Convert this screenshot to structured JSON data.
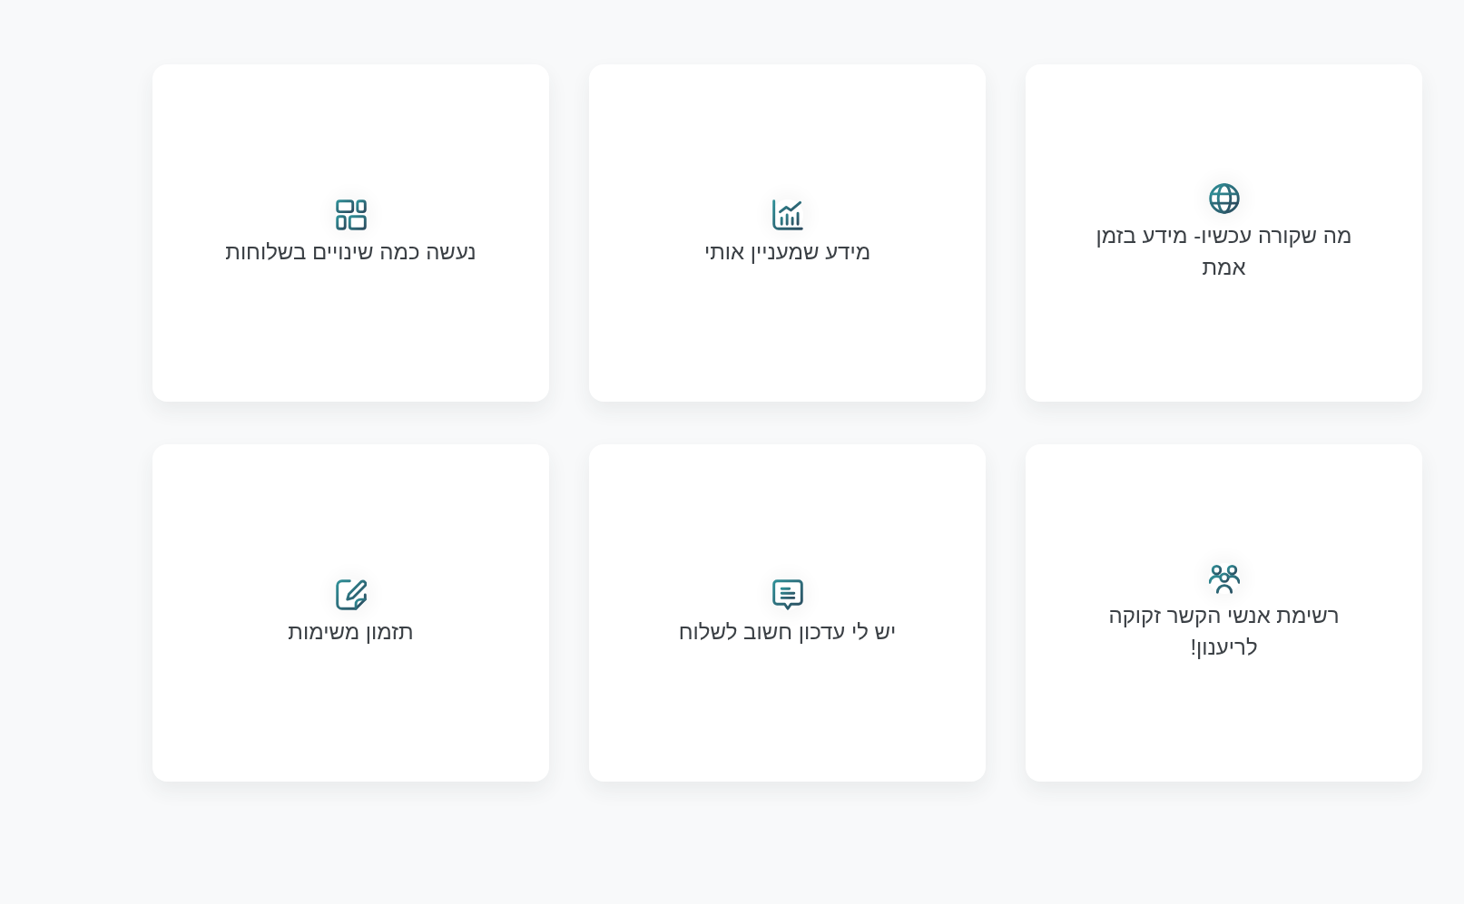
{
  "cards": [
    {
      "title": "מה שקורה עכשיו- מידע בזמן אמת"
    },
    {
      "title": "מידע שמעניין אותי"
    },
    {
      "title": "נעשה כמה שינויים בשלוחות"
    },
    {
      "title": "רשימת אנשי הקשר זקוקה לריענון!"
    },
    {
      "title": "יש לי עדכון חשוב לשלוח"
    },
    {
      "title": "תזמון משימות"
    }
  ]
}
